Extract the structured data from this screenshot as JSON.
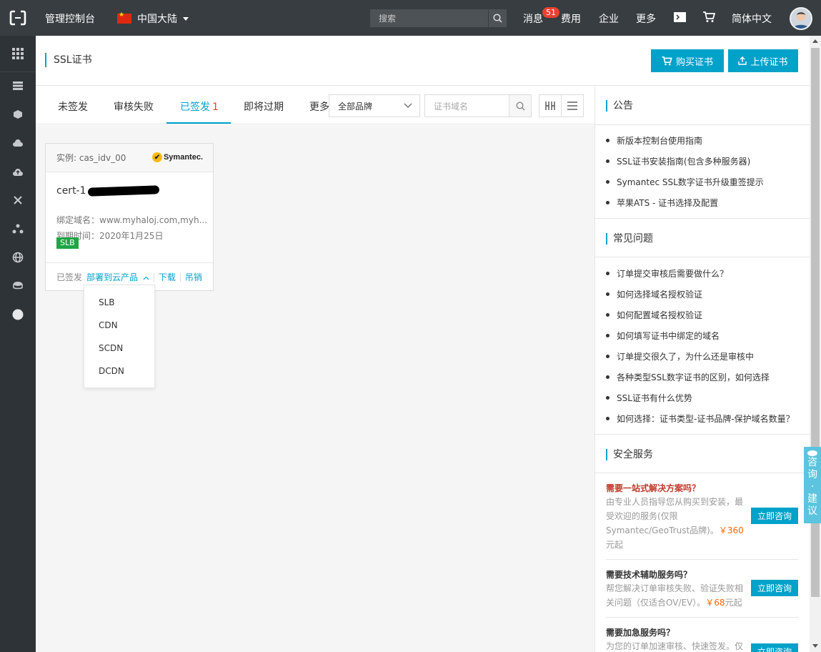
{
  "topbar": {
    "console_label": "管理控制台",
    "region_label": "中国大陆",
    "search_placeholder": "搜索",
    "nav": [
      "消息",
      "费用",
      "企业",
      "更多"
    ],
    "message_count": "51",
    "language_label": "简体中文"
  },
  "sidebar": {
    "icons": [
      "grid-icon",
      "list-icon",
      "cube-icon",
      "cloud-icon",
      "cloud-upload-icon",
      "network-icon",
      "cluster-icon",
      "globe-icon",
      "storage-icon",
      "circle-icon"
    ]
  },
  "page": {
    "title": "SSL证书",
    "buy_button": "购买证书",
    "upload_button": "上传证书"
  },
  "tabs": {
    "items": [
      {
        "label": "未签发"
      },
      {
        "label": "审核失败"
      },
      {
        "label": "已签发",
        "count": "1"
      },
      {
        "label": "即将过期"
      },
      {
        "label": "更多"
      }
    ],
    "brand_select": "全部品牌",
    "domain_placeholder": "证书域名"
  },
  "card": {
    "instance": "实例: cas_idv_00",
    "brand": "Symantec.",
    "cert_prefix": "cert-1",
    "domain_line": "绑定域名：www.myhaloj.com,myh...",
    "expire_line": "到期时间：2020年1月25日",
    "tag": "SLB",
    "status": "已签发",
    "deploy_link": "部署到云产品",
    "download_link": "下载",
    "revoke_link": "吊销"
  },
  "deploy_menu": [
    "SLB",
    "CDN",
    "SCDN",
    "DCDN"
  ],
  "right_panel": {
    "announcement_title": "公告",
    "announcements": [
      "新版本控制台使用指南",
      "SSL证书安装指南(包含多种服务器)",
      "Symantec SSL数字证书升级重签提示",
      "苹果ATS - 证书选择及配置"
    ],
    "faq_title": "常见问题",
    "faqs": [
      "订单提交审核后需要做什么？",
      "如何选择域名授权验证",
      "如何配置域名授权验证",
      "如何填写证书中绑定的域名",
      "订单提交很久了，为什么还是审核中",
      "各种类型SSL数字证书的区别，如何选择",
      "SSL证书有什么优势",
      "如何选择：证书类型-证书品牌-保护域名数量？"
    ],
    "security_title": "安全服务",
    "services": [
      {
        "title": "需要一站式解决方案吗？",
        "desc_a": "由专业人员指导您从购买到安装，最受欢迎的服务(仅限Symantec/GeoTrust品牌)。",
        "price": "￥360",
        "desc_b": "元起",
        "button": "立即咨询"
      },
      {
        "title": "需要技术辅助服务吗？",
        "desc_a": "帮您解决订单审核失败、验证失败相关问题（仅适合OV/EV）。",
        "price": "￥68",
        "desc_b": "元起",
        "button": "立即咨询"
      },
      {
        "title": "需要加急服务吗？",
        "desc_a": "为您的订单加速审核、快速签发。仅",
        "price": "",
        "desc_b": "",
        "button": "立即咨询"
      }
    ]
  },
  "consult_widget": [
    "咨",
    "询",
    "·",
    "建",
    "议"
  ],
  "colors": {
    "accent": "#00a2ca",
    "topbar": "#373d41",
    "sidebar": "#2e3338",
    "alert": "#e8412f",
    "tag_green": "#1fa544",
    "price": "#ff6600"
  }
}
